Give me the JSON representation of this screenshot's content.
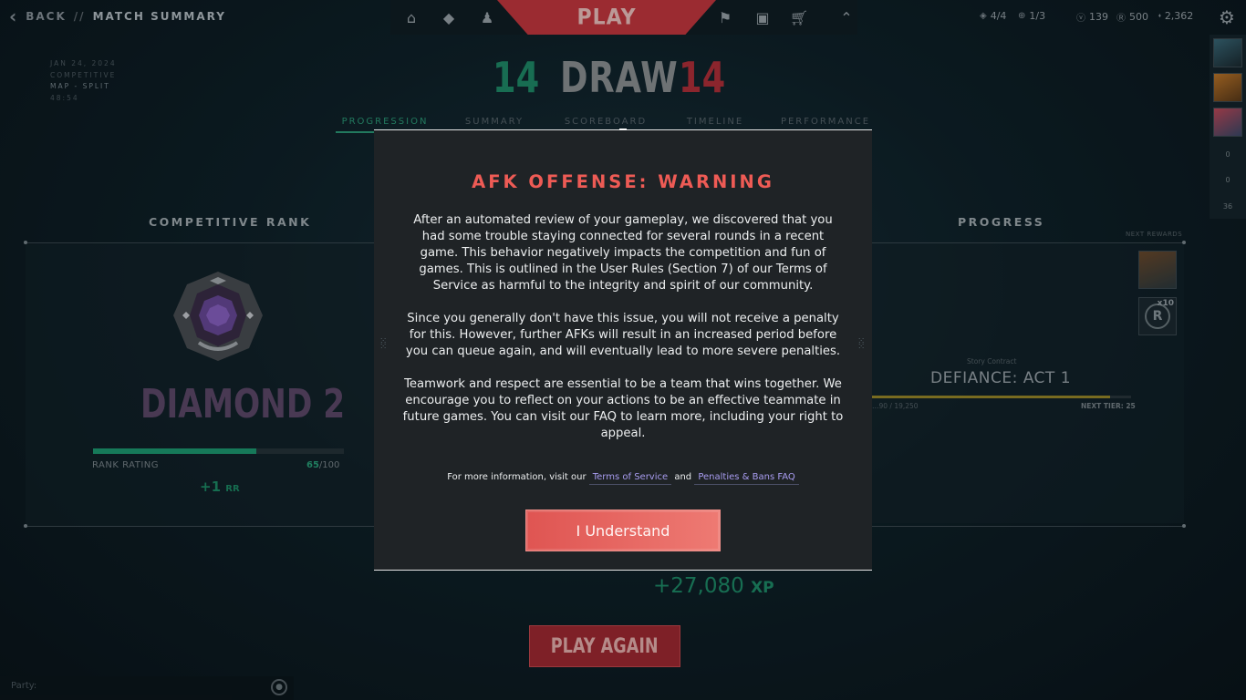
{
  "topbar": {
    "back_label": "BACK",
    "separator": "//",
    "current": "MATCH SUMMARY",
    "play_label": "PLAY",
    "currencies": [
      {
        "icon": "squad-icon",
        "value": "4/4"
      },
      {
        "icon": "plus-circle-icon",
        "value": "1/3"
      },
      {
        "icon": "valorant-points-icon",
        "value": "139"
      },
      {
        "icon": "radianite-icon",
        "value": "500"
      },
      {
        "icon": "kingdom-credits-icon",
        "value": "2,362"
      }
    ]
  },
  "match": {
    "date": "JAN 24, 2024",
    "mode": "COMPETITIVE",
    "map": "MAP - SPLIT",
    "duration": "48:54",
    "score_left": "14",
    "result": "DRAW",
    "score_right": "14",
    "tabs": [
      "PROGRESSION",
      "SUMMARY",
      "SCOREBOARD",
      "TIMELINE",
      "PERFORMANCE"
    ],
    "active_tab": "PROGRESSION"
  },
  "rank": {
    "title": "COMPETITIVE RANK",
    "name": "DIAMOND 2",
    "rating_label": "RANK RATING",
    "rating_value": "65",
    "rating_max": "/100",
    "rating_fraction": 0.65,
    "gain": "+1",
    "gain_unit": "RR"
  },
  "progress": {
    "title": "PROGRESS",
    "next_rewards_label": "NEXT REWARDS",
    "reward_multiplier": "x10",
    "contract_sub": "Story Contract",
    "contract_name": "DEFIANCE: ACT 1",
    "contract_xp": "…90 / 19,250",
    "next_tier": "NEXT TIER: 25",
    "total_xp": "+27,080",
    "xp_unit": "XP"
  },
  "play_again_label": "PLAY AGAIN",
  "party_label": "Party:",
  "roster_counts": [
    "0",
    "0",
    "36"
  ],
  "modal": {
    "title": "AFK OFFENSE: WARNING",
    "p1": "After an automated review of your gameplay, we discovered that you had some trouble staying connected for several rounds in a recent game. This behavior negatively impacts the competition and fun of games. This is outlined in the User Rules (Section 7) of our Terms of Service as harmful to the integrity and spirit of our community.",
    "p2": "Since you generally don't have this issue, you will not receive a penalty for this. However, further AFKs will result in an increased period before you can queue again, and will eventually lead to more severe penalties.",
    "p3": "Teamwork and respect are essential to be a team that wins together. We encourage you to reflect on your actions to be an effective teammate in future games. You can visit our FAQ to learn more, including your right to appeal.",
    "more_info_prefix": "For more information, visit our",
    "link_tos": "Terms of Service",
    "and": "and",
    "link_faq": "Penalties & Bans FAQ",
    "button_label": "I Understand"
  },
  "colors": {
    "accent_green": "#1f8c69",
    "accent_red": "#c7383f",
    "modal_title": "#ee5b55",
    "link": "#a89cf0"
  }
}
